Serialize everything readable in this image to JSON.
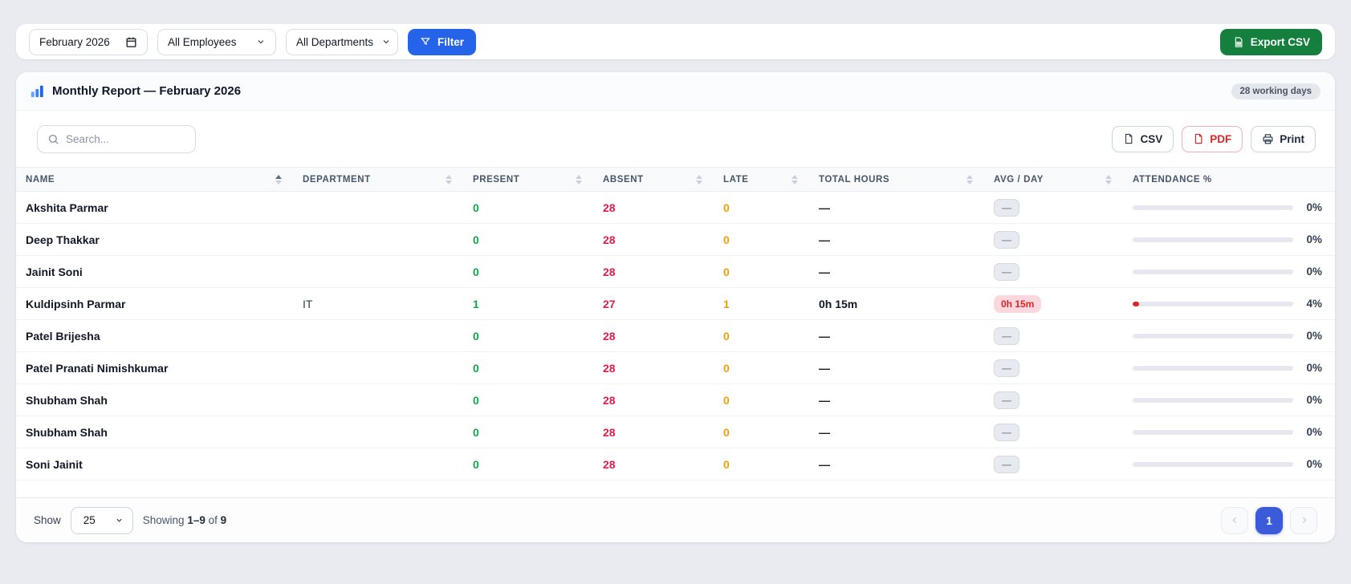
{
  "topbar": {
    "month_input": "February 2026",
    "employee_select": "All Employees",
    "department_select": "All Departments",
    "filter_button": "Filter",
    "export_button": "Export CSV"
  },
  "report": {
    "title": "Monthly Report — February 2026",
    "working_days_badge": "28 working days",
    "search_placeholder": "Search...",
    "csv_button": "CSV",
    "pdf_button": "PDF",
    "print_button": "Print"
  },
  "table": {
    "columns": [
      {
        "label": "NAME",
        "sorted": "asc",
        "sortable": true
      },
      {
        "label": "DEPARTMENT",
        "sortable": true
      },
      {
        "label": "PRESENT",
        "sortable": true
      },
      {
        "label": "ABSENT",
        "sortable": true
      },
      {
        "label": "LATE",
        "sortable": true
      },
      {
        "label": "TOTAL HOURS",
        "sortable": true
      },
      {
        "label": "AVG / DAY",
        "sortable": true
      },
      {
        "label": "ATTENDANCE %",
        "sortable": false
      }
    ],
    "rows": [
      {
        "name": "Akshita Parmar",
        "department": "",
        "present": "0",
        "absent": "28",
        "late": "0",
        "total_hours": "—",
        "avg_day": "—",
        "avg_day_style": "muted",
        "attendance_pct": 0,
        "attendance_label": "0%"
      },
      {
        "name": "Deep Thakkar",
        "department": "",
        "present": "0",
        "absent": "28",
        "late": "0",
        "total_hours": "—",
        "avg_day": "—",
        "avg_day_style": "muted",
        "attendance_pct": 0,
        "attendance_label": "0%"
      },
      {
        "name": "Jainit Soni",
        "department": "",
        "present": "0",
        "absent": "28",
        "late": "0",
        "total_hours": "—",
        "avg_day": "—",
        "avg_day_style": "muted",
        "attendance_pct": 0,
        "attendance_label": "0%"
      },
      {
        "name": "Kuldipsinh Parmar",
        "department": "IT",
        "present": "1",
        "absent": "27",
        "late": "1",
        "total_hours": "0h 15m",
        "avg_day": "0h 15m",
        "avg_day_style": "danger",
        "attendance_pct": 4,
        "attendance_label": "4%"
      },
      {
        "name": "Patel Brijesha",
        "department": "",
        "present": "0",
        "absent": "28",
        "late": "0",
        "total_hours": "—",
        "avg_day": "—",
        "avg_day_style": "muted",
        "attendance_pct": 0,
        "attendance_label": "0%"
      },
      {
        "name": "Patel Pranati Nimishkumar",
        "department": "",
        "present": "0",
        "absent": "28",
        "late": "0",
        "total_hours": "—",
        "avg_day": "—",
        "avg_day_style": "muted",
        "attendance_pct": 0,
        "attendance_label": "0%"
      },
      {
        "name": "Shubham Shah",
        "department": "",
        "present": "0",
        "absent": "28",
        "late": "0",
        "total_hours": "—",
        "avg_day": "—",
        "avg_day_style": "muted",
        "attendance_pct": 0,
        "attendance_label": "0%"
      },
      {
        "name": "Shubham Shah",
        "department": "",
        "present": "0",
        "absent": "28",
        "late": "0",
        "total_hours": "—",
        "avg_day": "—",
        "avg_day_style": "muted",
        "attendance_pct": 0,
        "attendance_label": "0%"
      },
      {
        "name": "Soni Jainit",
        "department": "",
        "present": "0",
        "absent": "28",
        "late": "0",
        "total_hours": "—",
        "avg_day": "—",
        "avg_day_style": "muted",
        "attendance_pct": 0,
        "attendance_label": "0%"
      }
    ]
  },
  "footer": {
    "show_label": "Show",
    "page_size_value": "25",
    "showing_prefix": "Showing",
    "showing_range": "1–9",
    "showing_of": "of",
    "showing_total": "9",
    "current_page": "1"
  },
  "colors": {
    "accent_blue": "#2563eb",
    "export_green": "#15803d",
    "present_green": "#16a34a",
    "absent_red": "#e11d48",
    "late_amber": "#f59e0b",
    "pdf_red": "#dc2626",
    "pagination_active": "#3b5bdb"
  }
}
